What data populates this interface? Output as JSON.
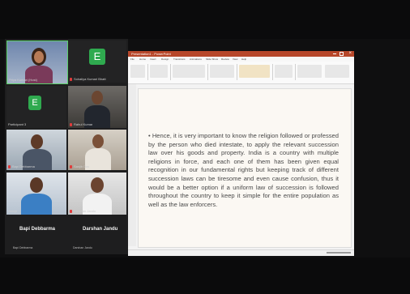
{
  "participants": [
    {
      "name": "Priya Kumari (Host)",
      "kind": "video",
      "highlighted": true
    },
    {
      "name": "Sohaliya Kumari Bhatt",
      "kind": "avatar",
      "initial": "E"
    },
    {
      "name": "Participant 3",
      "kind": "avatar",
      "initial": "E"
    },
    {
      "name": "Rahul Kumar",
      "kind": "video"
    },
    {
      "name": "Bapi Debbarma",
      "kind": "video"
    },
    {
      "name": "Sanjib Das",
      "kind": "video"
    },
    {
      "name": "Abhijit",
      "kind": "video"
    },
    {
      "name": "Dorshan Jandu",
      "kind": "video"
    }
  ],
  "featured_names": {
    "left": "Bapi Debbarma",
    "right": "Darshan Jandu",
    "left_small": "Bapi Debbarma",
    "right_small": "Darshan Jandu"
  },
  "powerpoint": {
    "window_title": "Presentation1 - PowerPoint",
    "tabs": [
      "File",
      "Home",
      "Insert",
      "Design",
      "Transitions",
      "Animations",
      "Slide Show",
      "Review",
      "View",
      "Help"
    ]
  },
  "slide": {
    "text": "• Hence, it is very important to know the religion followed or professed by the person who died intestate, to apply the relevant succession law over his goods and property. India is a country with multiple religions in force, and each one of them has been given equal recognition in our fundamental rights but keeping track of different succession laws can be tiresome and even cause confusion, thus it would be a better option if a uniform law of succession is followed throughout the country to keep it simple for the entire population as well as the law enforcers."
  },
  "colors": {
    "ppt_accent": "#b7472a",
    "avatar_green": "#2faa4f",
    "active_speaker_border": "#5bd06a"
  }
}
